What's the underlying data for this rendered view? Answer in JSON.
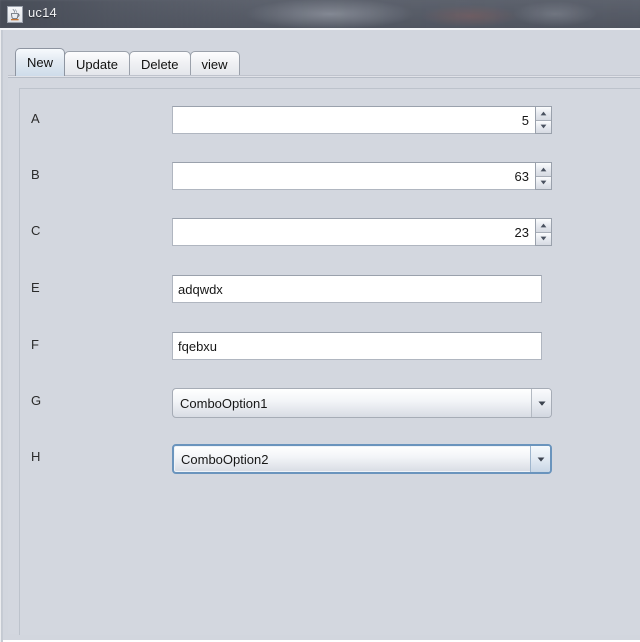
{
  "window": {
    "title": "uc14",
    "icon": "java-coffee-cup-icon"
  },
  "tabs": [
    {
      "label": "New",
      "selected": true
    },
    {
      "label": "Update",
      "selected": false
    },
    {
      "label": "Delete",
      "selected": false
    },
    {
      "label": "view",
      "selected": false
    }
  ],
  "form": {
    "rows": [
      {
        "label": "A",
        "type": "spinner",
        "value": "5"
      },
      {
        "label": "B",
        "type": "spinner",
        "value": "63"
      },
      {
        "label": "C",
        "type": "spinner",
        "value": "23"
      },
      {
        "label": "E",
        "type": "text",
        "value": "adqwdx",
        "placeholder": ""
      },
      {
        "label": "F",
        "type": "text",
        "value": "fqebxu",
        "placeholder": ""
      },
      {
        "label": "G",
        "type": "combo",
        "value": "ComboOption1",
        "focused": false
      },
      {
        "label": "H",
        "type": "combo",
        "value": "ComboOption2",
        "focused": true
      }
    ]
  },
  "colors": {
    "panel_background": "#d3d7df",
    "titlebar": "#565b66",
    "field_background": "#ffffff",
    "focus_border": "#6a94bd",
    "selected_tab": "#cedcea"
  }
}
